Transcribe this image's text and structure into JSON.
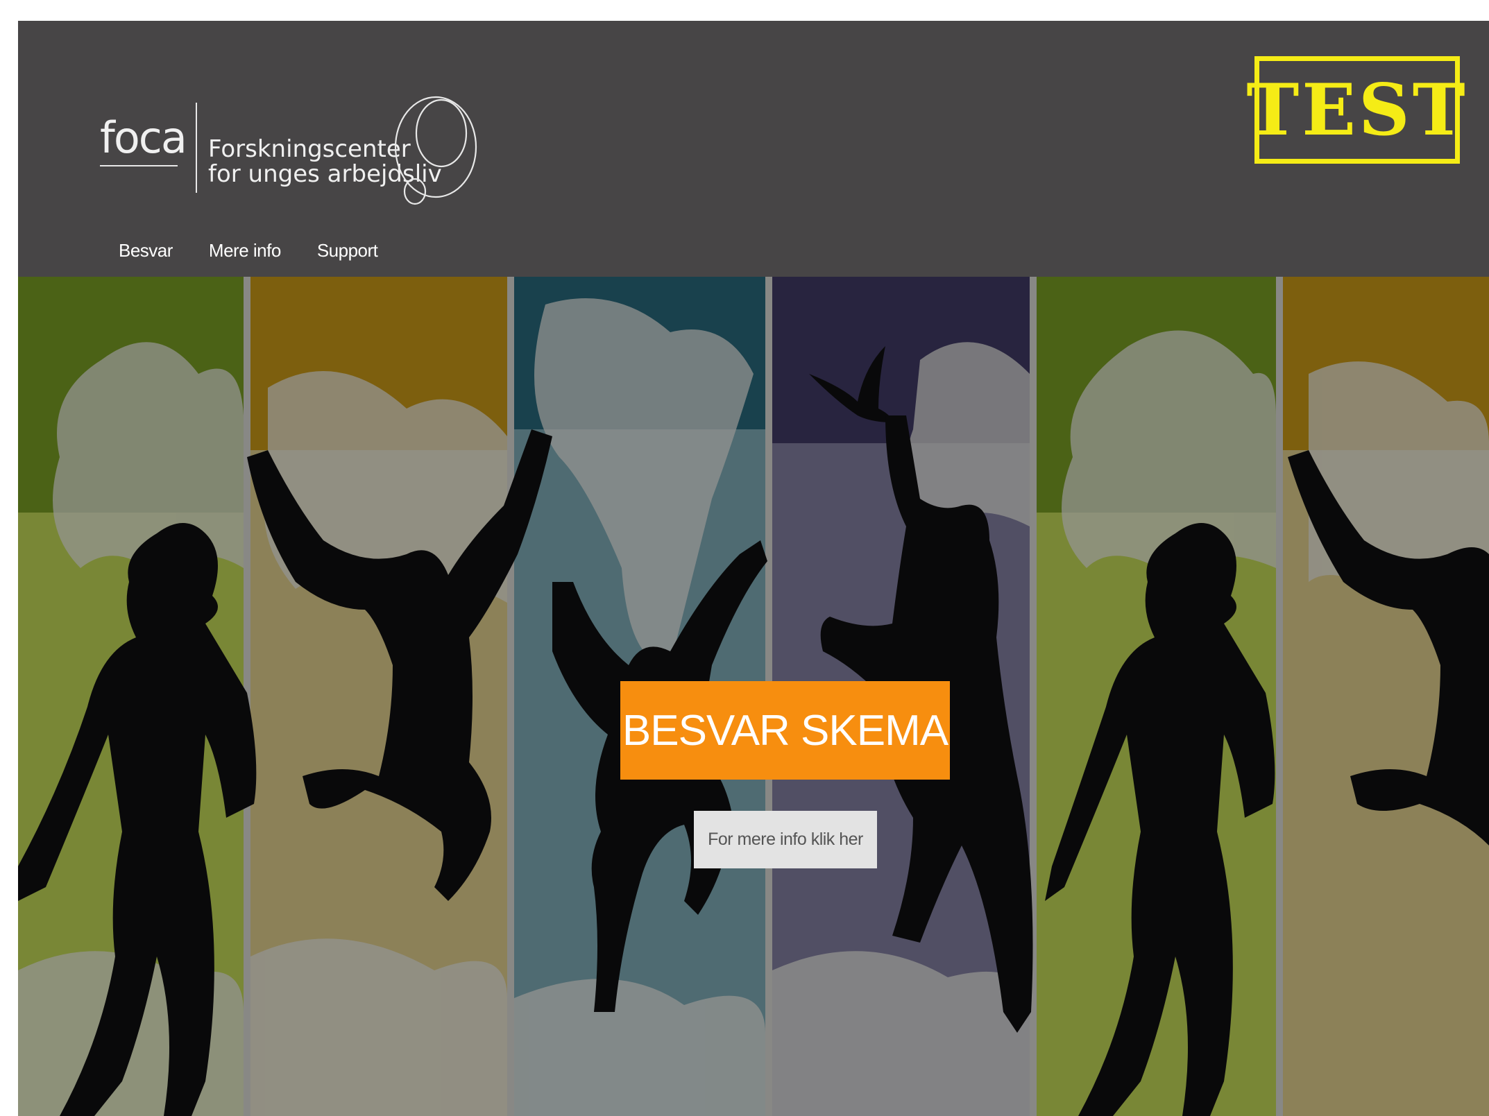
{
  "header": {
    "logo": {
      "wordmark": "foca",
      "line1": "Forskningscenter",
      "line2": "for unges arbejdsliv"
    },
    "badge": "TEST"
  },
  "nav": {
    "items": [
      {
        "label": "Besvar"
      },
      {
        "label": "Mere info"
      },
      {
        "label": "Support"
      }
    ]
  },
  "hero": {
    "primary_button": "BESVAR SKEMA",
    "secondary_button": "For mere info klik her"
  },
  "colors": {
    "header_bg": "#474546",
    "accent_orange": "#f78e0f",
    "badge_yellow": "#f5ec16",
    "secondary_button_bg": "#e3e3e3"
  }
}
